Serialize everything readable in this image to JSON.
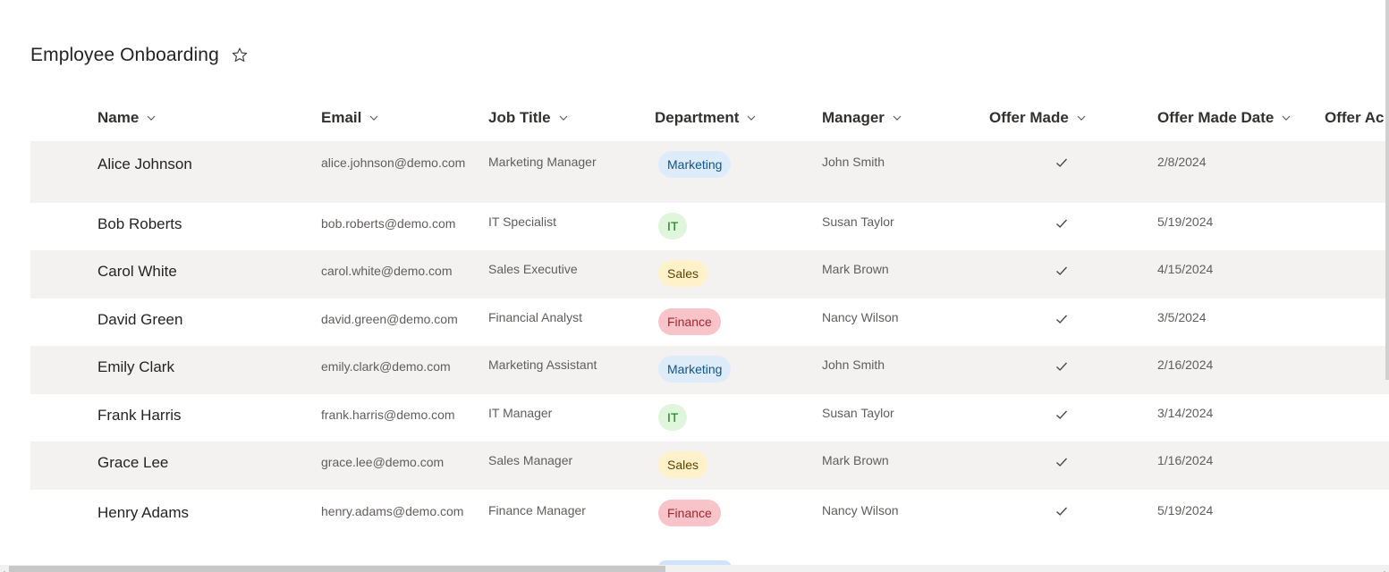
{
  "list": {
    "title": "Employee Onboarding"
  },
  "columns": [
    {
      "label": "Name",
      "key": "name"
    },
    {
      "label": "Email",
      "key": "email"
    },
    {
      "label": "Job Title",
      "key": "job"
    },
    {
      "label": "Department",
      "key": "dept"
    },
    {
      "label": "Manager",
      "key": "manager"
    },
    {
      "label": "Offer Made",
      "key": "offer"
    },
    {
      "label": "Offer Made Date",
      "key": "date"
    },
    {
      "label": "Offer Ac",
      "key": "offer_ac"
    }
  ],
  "departments": {
    "Marketing": {
      "bg": "#deecf9",
      "fg": "#0f548c"
    },
    "IT": {
      "bg": "#dff6dd",
      "fg": "#107c10"
    },
    "Sales": {
      "bg": "#fff1c9",
      "fg": "#5c4300"
    },
    "Finance": {
      "bg": "#f8c4ca",
      "fg": "#a4262c"
    }
  },
  "rows": [
    {
      "name": "Alice Johnson",
      "email": "alice.johnson@demo.com",
      "job": "Marketing Manager",
      "dept": "Marketing",
      "manager": "John Smith",
      "offer": true,
      "date": "2/8/2024"
    },
    {
      "name": "Bob Roberts",
      "email": "bob.roberts@demo.com",
      "job": "IT Specialist",
      "dept": "IT",
      "manager": "Susan Taylor",
      "offer": true,
      "date": "5/19/2024"
    },
    {
      "name": "Carol White",
      "email": "carol.white@demo.com",
      "job": "Sales Executive",
      "dept": "Sales",
      "manager": "Mark Brown",
      "offer": true,
      "date": "4/15/2024"
    },
    {
      "name": "David Green",
      "email": "david.green@demo.com",
      "job": "Financial Analyst",
      "dept": "Finance",
      "manager": "Nancy Wilson",
      "offer": true,
      "date": "3/5/2024"
    },
    {
      "name": "Emily Clark",
      "email": "emily.clark@demo.com",
      "job": "Marketing Assistant",
      "dept": "Marketing",
      "manager": "John Smith",
      "offer": true,
      "date": "2/16/2024"
    },
    {
      "name": "Frank Harris",
      "email": "frank.harris@demo.com",
      "job": "IT Manager",
      "dept": "IT",
      "manager": "Susan Taylor",
      "offer": true,
      "date": "3/14/2024"
    },
    {
      "name": "Grace Lee",
      "email": "grace.lee@demo.com",
      "job": "Sales Manager",
      "dept": "Sales",
      "manager": "Mark Brown",
      "offer": true,
      "date": "1/16/2024"
    },
    {
      "name": "Henry Adams",
      "email": "henry.adams@demo.com",
      "job": "Finance Manager",
      "dept": "Finance",
      "manager": "Nancy Wilson",
      "offer": true,
      "date": "5/19/2024"
    }
  ],
  "icons": {
    "favorite": "star-outline-icon",
    "sort": "chevron-down-icon",
    "check": "checkmark-icon"
  }
}
